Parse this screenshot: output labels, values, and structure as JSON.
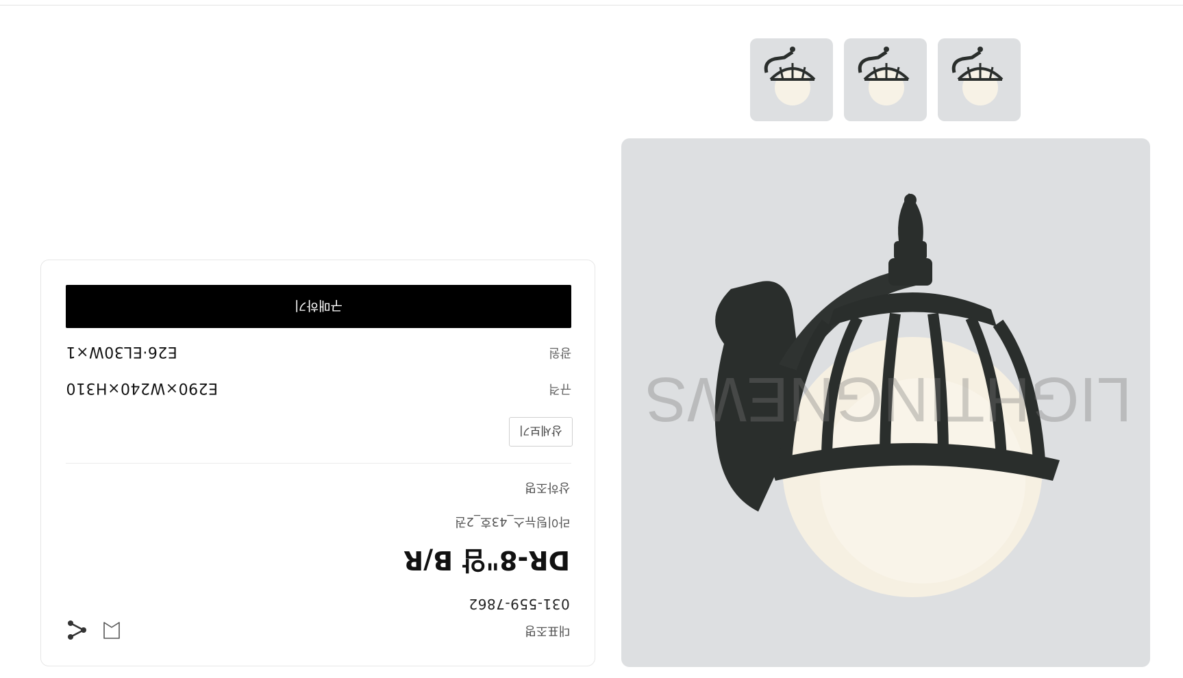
{
  "product": {
    "company_label": "대표조명",
    "phone": "031-559-7862",
    "name": "DR-8\"암 B/R",
    "catalog": "라이팅뉴스_43호_2권",
    "brand": "상하조명",
    "detail_button": "상세보기",
    "specs": [
      {
        "label": "규격",
        "value": "E290×W240×H310"
      },
      {
        "label": "광원",
        "value": "E26·EL30W×1"
      }
    ],
    "buy_button": "구매하기"
  },
  "actions": {
    "share_icon": "share-icon",
    "bookmark_icon": "bookmark-icon"
  },
  "images": {
    "main_alt": "outdoor wall lamp",
    "thumbnail_count": 3,
    "watermark": "LIGHTINGNEWS"
  },
  "colors": {
    "buy_button_bg": "#000000",
    "image_bg": "#dddfe1",
    "lamp_body": "#2a2e2c",
    "globe": "#f7f2e6"
  }
}
